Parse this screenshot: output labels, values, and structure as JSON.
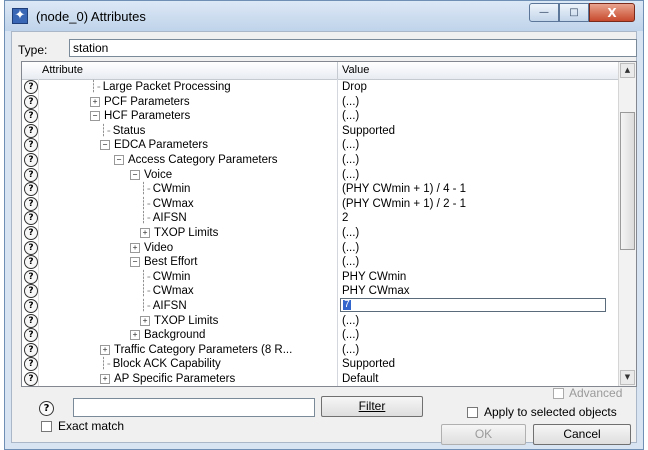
{
  "window": {
    "title": "(node_0) Attributes",
    "minimize_glyph": "—",
    "maximize_glyph": "□",
    "close_glyph": "X"
  },
  "type_field": {
    "label": "Type:",
    "value": "station"
  },
  "grid": {
    "headers": {
      "attribute": "Attribute",
      "value": "Value"
    },
    "rows": [
      {
        "attribute": "Large Packet Processing",
        "value": "Drop",
        "indent": 1,
        "node": "leaf"
      },
      {
        "attribute": "PCF Parameters",
        "value": "(...)",
        "indent": 1,
        "node": "collapsed"
      },
      {
        "attribute": "HCF Parameters",
        "value": "(...)",
        "indent": 1,
        "node": "expanded"
      },
      {
        "attribute": "Status",
        "value": "Supported",
        "indent": 2,
        "node": "leaf"
      },
      {
        "attribute": "EDCA Parameters",
        "value": "(...)",
        "indent": 2,
        "node": "expanded"
      },
      {
        "attribute": "Access Category Parameters",
        "value": "(...)",
        "indent": 3,
        "node": "expanded"
      },
      {
        "attribute": "Voice",
        "value": "(...)",
        "indent": 4,
        "node": "expanded"
      },
      {
        "attribute": "CWmin",
        "value": "(PHY CWmin + 1) / 4 - 1",
        "indent": 5,
        "node": "leaf"
      },
      {
        "attribute": "CWmax",
        "value": "(PHY CWmin + 1) / 2 - 1",
        "indent": 5,
        "node": "leaf"
      },
      {
        "attribute": "AIFSN",
        "value": "2",
        "indent": 5,
        "node": "leaf"
      },
      {
        "attribute": "TXOP Limits",
        "value": "(...)",
        "indent": 5,
        "node": "collapsed"
      },
      {
        "attribute": "Video",
        "value": "(...)",
        "indent": 4,
        "node": "collapsed"
      },
      {
        "attribute": "Best Effort",
        "value": "(...)",
        "indent": 4,
        "node": "expanded"
      },
      {
        "attribute": "CWmin",
        "value": "PHY CWmin",
        "indent": 5,
        "node": "leaf"
      },
      {
        "attribute": "CWmax",
        "value": "PHY CWmax",
        "indent": 5,
        "node": "leaf"
      },
      {
        "attribute": "AIFSN",
        "value": "7",
        "indent": 5,
        "node": "leaf",
        "editing": true
      },
      {
        "attribute": "TXOP Limits",
        "value": "(...)",
        "indent": 5,
        "node": "collapsed"
      },
      {
        "attribute": "Background",
        "value": "(...)",
        "indent": 4,
        "node": "collapsed"
      },
      {
        "attribute": "Traffic Category Parameters (8 R...",
        "value": "(...)",
        "indent": 2,
        "node": "collapsed"
      },
      {
        "attribute": "Block ACK Capability",
        "value": "Supported",
        "indent": 2,
        "node": "leaf"
      },
      {
        "attribute": "AP Specific Parameters",
        "value": "Default",
        "indent": 2,
        "node": "collapsed"
      }
    ],
    "help_glyph": "?",
    "scroll_up_glyph": "▲",
    "scroll_down_glyph": "▼"
  },
  "bottom": {
    "help_glyph": "?",
    "search_value": "",
    "filter_label": "Filter",
    "exact_match_label": "Exact match",
    "advanced_label": "Advanced",
    "apply_selected_label": "Apply to selected objects",
    "ok_label": "OK",
    "cancel_label": "Cancel"
  }
}
